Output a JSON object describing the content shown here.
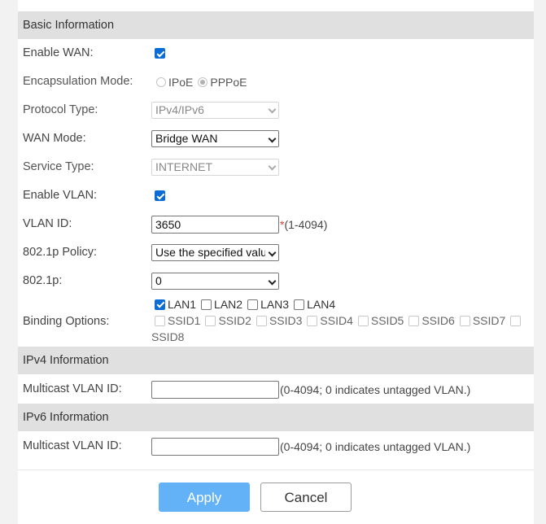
{
  "sections": {
    "basic": "Basic Information",
    "ipv4": "IPv4 Information",
    "ipv6": "IPv6 Information"
  },
  "fields": {
    "enable_wan": {
      "label": "Enable WAN:",
      "checked": true
    },
    "encapsulation": {
      "label": "Encapsulation Mode:",
      "options": [
        "IPoE",
        "PPPoE"
      ],
      "selected": "PPPoE"
    },
    "protocol_type": {
      "label": "Protocol Type:",
      "value": "IPv4/IPv6"
    },
    "wan_mode": {
      "label": "WAN Mode:",
      "value": "Bridge WAN"
    },
    "service_type": {
      "label": "Service Type:",
      "value": "INTERNET"
    },
    "enable_vlan": {
      "label": "Enable VLAN:",
      "checked": true
    },
    "vlan_id": {
      "label": "VLAN ID:",
      "value": "3650",
      "required": "*",
      "hint": "(1-4094)"
    },
    "policy_8021p": {
      "label": "802.1p Policy:",
      "value": "Use the specified value"
    },
    "p8021": {
      "label": "802.1p:",
      "value": "0"
    },
    "binding": {
      "label": "Binding Options:",
      "lan": [
        {
          "name": "LAN1",
          "checked": true
        },
        {
          "name": "LAN2",
          "checked": false
        },
        {
          "name": "LAN3",
          "checked": false
        },
        {
          "name": "LAN4",
          "checked": false
        }
      ],
      "ssid": [
        "SSID1",
        "SSID2",
        "SSID3",
        "SSID4",
        "SSID5",
        "SSID6",
        "SSID7",
        "SSID8"
      ]
    },
    "ipv4_mcast": {
      "label": "Multicast VLAN ID:",
      "value": "",
      "hint": "(0-4094; 0 indicates untagged VLAN.)"
    },
    "ipv6_mcast": {
      "label": "Multicast VLAN ID:",
      "value": "",
      "hint": "(0-4094; 0 indicates untagged VLAN.)"
    }
  },
  "buttons": {
    "apply": "Apply",
    "cancel": "Cancel"
  }
}
